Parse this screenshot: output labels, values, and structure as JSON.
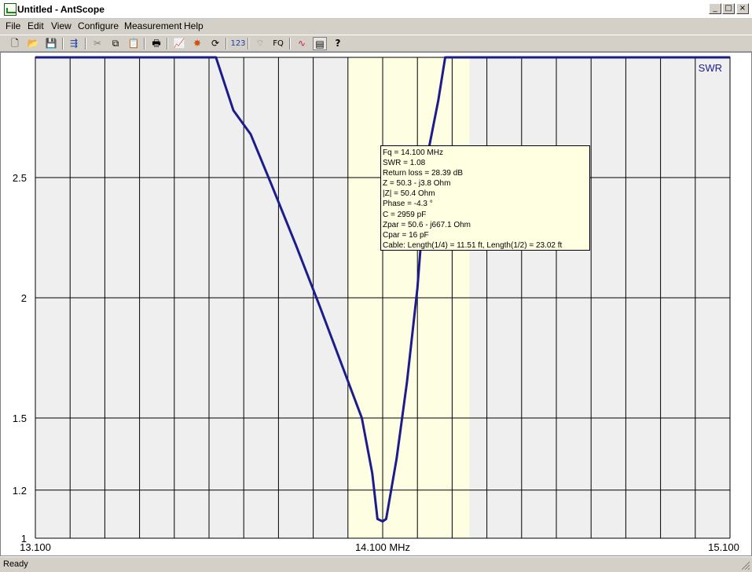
{
  "window": {
    "title": "Untitled - AntScope",
    "icon": "antscope-app-icon",
    "controls": {
      "minimize": "_",
      "maximize": "□",
      "close": "×"
    }
  },
  "menu": [
    "File",
    "Edit",
    "View",
    "Configure",
    "Measurement",
    "Help"
  ],
  "toolbar": {
    "buttons": [
      {
        "name": "new-file-icon",
        "glyph": "🗋"
      },
      {
        "name": "open-folder-icon",
        "glyph": "📂"
      },
      {
        "name": "save-icon",
        "glyph": "💾"
      },
      {
        "name": "export-icon",
        "glyph": "⇶"
      },
      {
        "name": "cut-icon",
        "glyph": "✂"
      },
      {
        "name": "copy-icon",
        "glyph": "⧉"
      },
      {
        "name": "paste-icon",
        "glyph": "📋"
      },
      {
        "name": "print-icon",
        "glyph": "🖶"
      },
      {
        "name": "chart-icon",
        "glyph": "📈"
      },
      {
        "name": "scan-icon",
        "glyph": "✸"
      },
      {
        "name": "refresh-icon",
        "glyph": "⟳"
      },
      {
        "name": "numeric-icon",
        "glyph": "123"
      },
      {
        "name": "wireless-icon",
        "glyph": "⌔"
      },
      {
        "name": "frequency-icon",
        "glyph": "FQ"
      },
      {
        "name": "curves-icon",
        "glyph": "∿"
      },
      {
        "name": "panel-icon",
        "glyph": "▤"
      },
      {
        "name": "help-icon",
        "glyph": "?"
      }
    ]
  },
  "chart_data": {
    "type": "line",
    "series": [
      {
        "name": "SWR",
        "color": "#1c1c8c",
        "x": [
          13.1,
          13.62,
          13.67,
          13.72,
          13.78,
          13.85,
          13.92,
          13.98,
          14.04,
          14.07,
          14.085,
          14.1,
          14.11,
          14.14,
          14.17,
          14.2,
          14.23,
          14.26,
          14.28,
          14.3,
          15.1
        ],
        "y": [
          3.0,
          3.0,
          2.78,
          2.68,
          2.47,
          2.22,
          1.96,
          1.73,
          1.5,
          1.27,
          1.08,
          1.07,
          1.08,
          1.33,
          1.65,
          2.04,
          2.6,
          2.82,
          3.0,
          3.0,
          3.0
        ]
      }
    ],
    "xlim": [
      13.1,
      15.1
    ],
    "ylim": [
      1.0,
      3.0
    ],
    "x_ticks": [
      13.1,
      14.1,
      15.1
    ],
    "x_tick_labels": [
      "13.100",
      "14.100 MHz",
      "15.100"
    ],
    "y_ticks": [
      1.0,
      1.2,
      1.5,
      2.0,
      2.5
    ],
    "y_tick_labels": [
      "1",
      "1.2",
      "1.5",
      "2",
      "2.5"
    ],
    "grid": true,
    "band_highlight": [
      14.0,
      14.35
    ],
    "legend": "top-right",
    "colors": {
      "plot_bg": "#efefef",
      "band_bg": "#fefee2",
      "grid": "#000000",
      "line": "#1c1c8c"
    }
  },
  "tooltip": {
    "lines": [
      "Fq = 14.100 MHz",
      "SWR = 1.08",
      "Return loss = 28.39 dB",
      "Z = 50.3 - j3.8 Ohm",
      "|Z| = 50.4 Ohm",
      "Phase = -4.3 °",
      "C = 2959 pF",
      "Zpar = 50.6 - j667.1 Ohm",
      "Cpar = 16 pF",
      "Cable: Length(1/4) = 11.51 ft, Length(1/2) = 23.02 ft"
    ]
  },
  "status": {
    "text": "Ready"
  }
}
